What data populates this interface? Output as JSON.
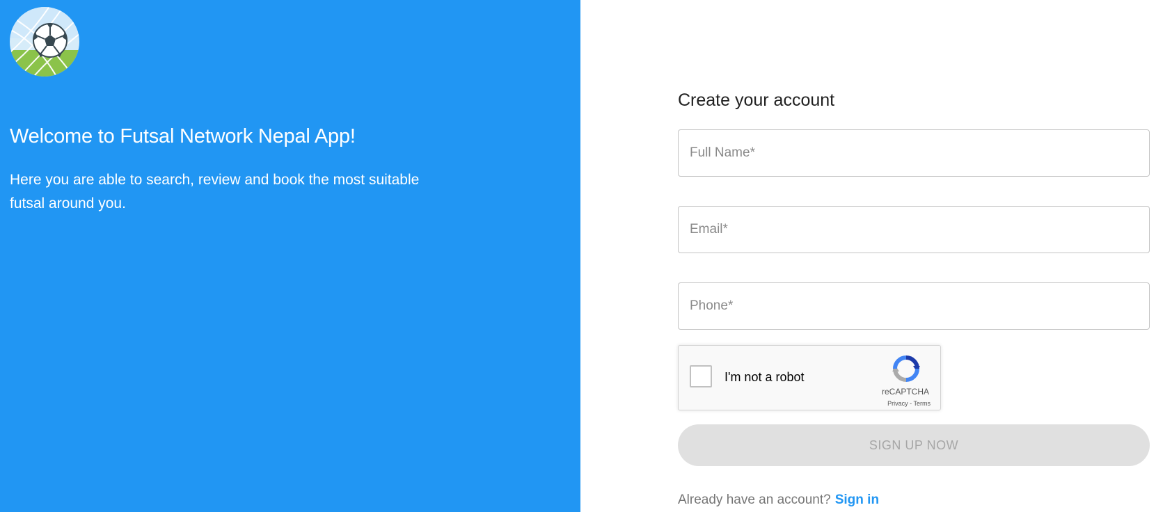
{
  "welcome": {
    "logo_icon": "soccer-ball-net-icon",
    "title": "Welcome to Futsal Network Nepal App!",
    "description": "Here you are able to search, review and book the most suitable futsal around you."
  },
  "form": {
    "title": "Create your account",
    "full_name": {
      "placeholder": "Full Name*",
      "value": ""
    },
    "email": {
      "placeholder": "Email*",
      "value": ""
    },
    "phone": {
      "placeholder": "Phone*",
      "value": ""
    },
    "captcha": {
      "label": "I'm not a robot",
      "brand": "reCAPTCHA",
      "links": "Privacy - Terms",
      "icon": "recaptcha-icon"
    },
    "submit_label": "SIGN UP NOW",
    "signin_prompt": "Already have an account?",
    "signin_link": "Sign in"
  },
  "colors": {
    "brand_blue": "#2196f3",
    "button_disabled_bg": "#e0e0e0",
    "button_disabled_text": "#a6a6a6"
  }
}
